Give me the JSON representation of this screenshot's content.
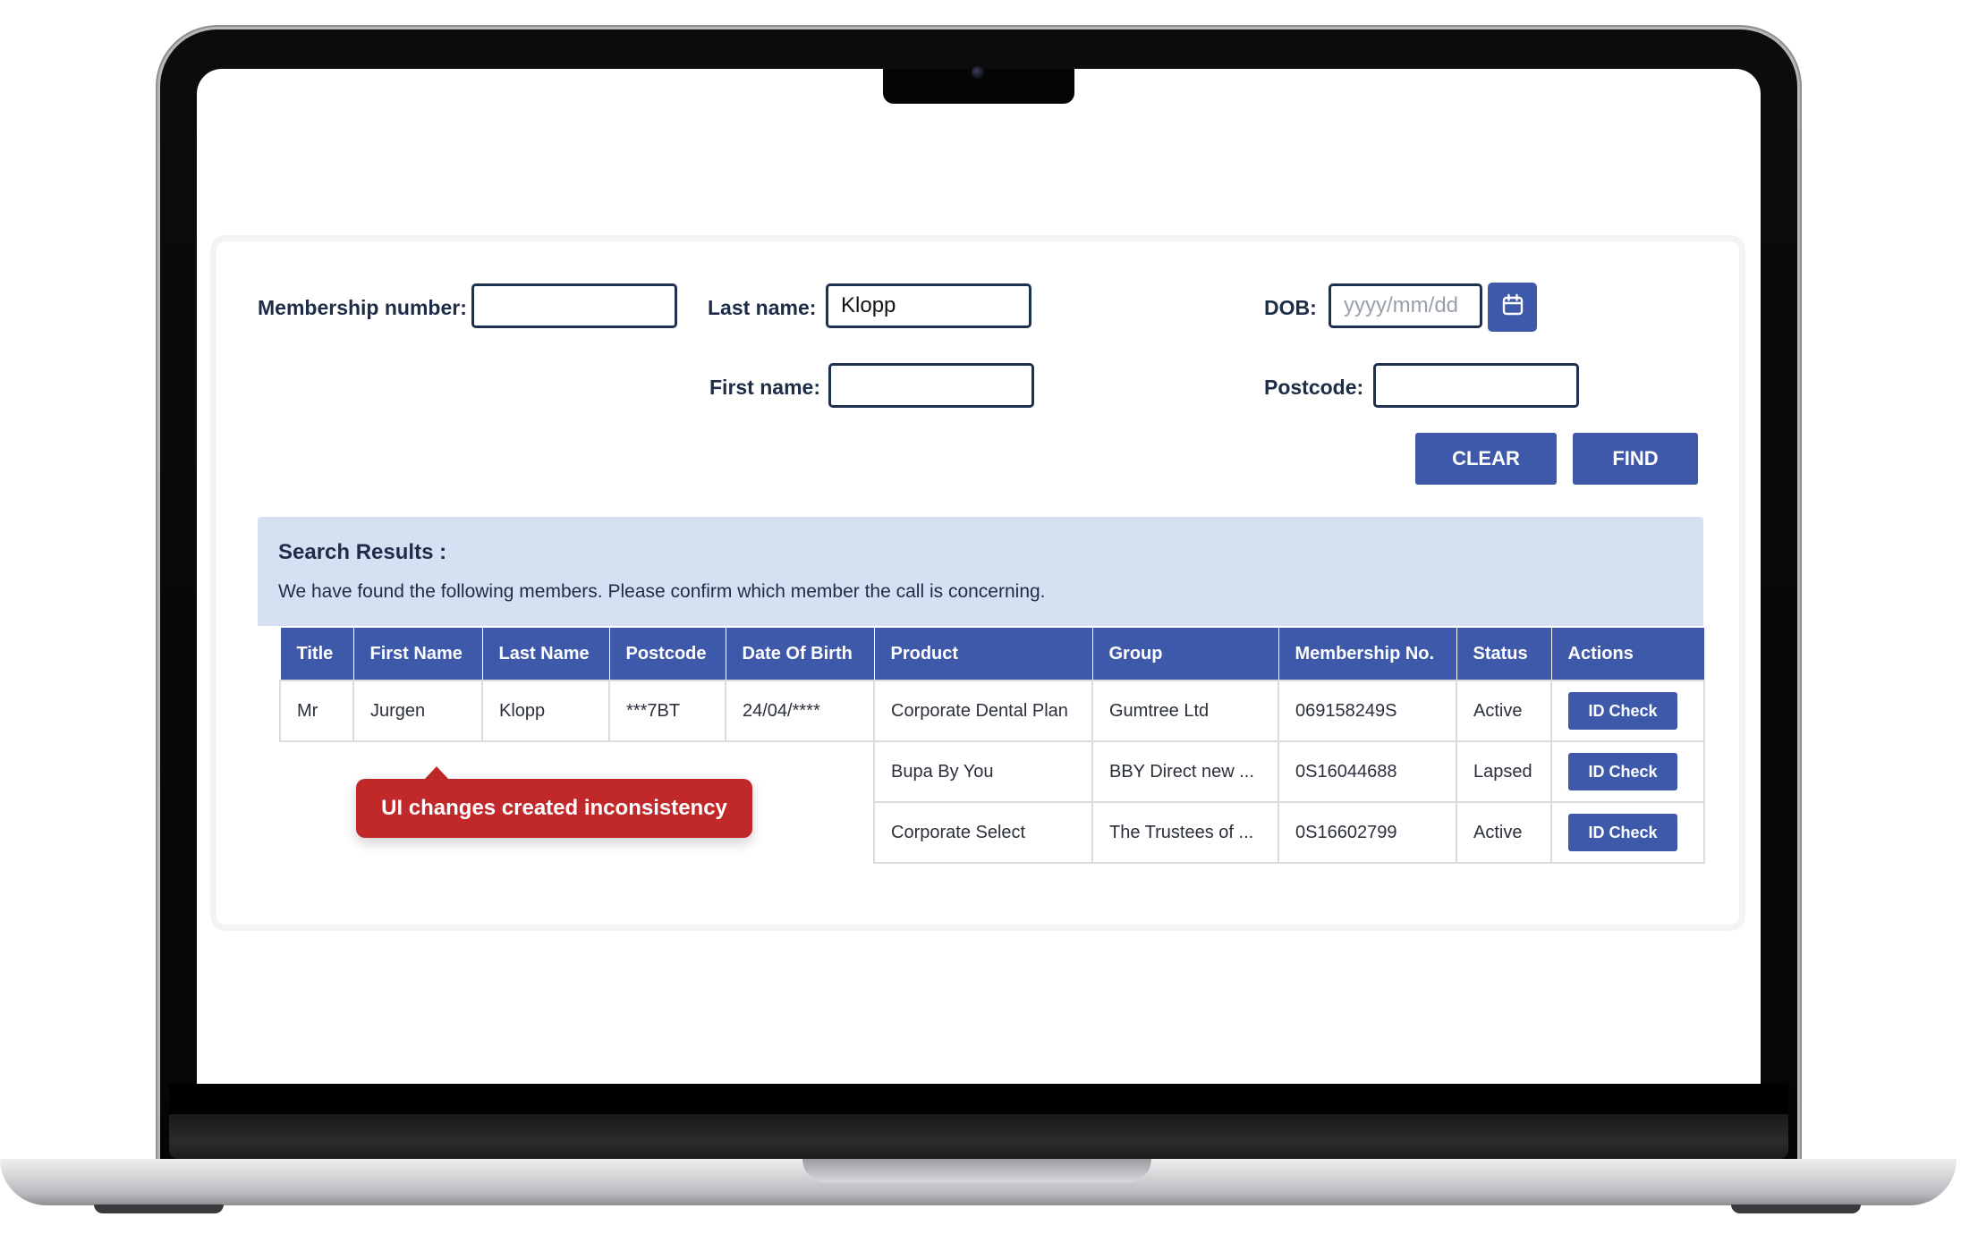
{
  "search_form": {
    "membership_number_label": "Membership number:",
    "membership_number_value": "",
    "last_name_label": "Last name:",
    "last_name_value": "Klopp",
    "first_name_label": "First name:",
    "first_name_value": "",
    "dob_label": "DOB:",
    "dob_placeholder": "yyyy/mm/dd",
    "postcode_label": "Postcode:",
    "postcode_value": "",
    "clear_label": "CLEAR",
    "find_label": "FIND"
  },
  "results": {
    "title": "Search Results :",
    "subtitle": "We have found the following members. Please confirm which member the call is concerning.",
    "columns": [
      "Title",
      "First Name",
      "Last Name",
      "Postcode",
      "Date Of Birth",
      "Product",
      "Group",
      "Membership No.",
      "Status",
      "Actions"
    ],
    "person": {
      "title": "Mr",
      "first_name": "Jurgen",
      "last_name": "Klopp",
      "postcode": "***7BT",
      "dob": "24/04/****"
    },
    "rows": [
      {
        "product": "Corporate Dental Plan",
        "group": "Gumtree Ltd",
        "membership_no": "069158249S",
        "status": "Active",
        "action": "ID Check"
      },
      {
        "product": "Bupa By You",
        "group": "BBY Direct new ...",
        "membership_no": "0S16044688",
        "status": "Lapsed",
        "action": "ID Check"
      },
      {
        "product": "Corporate Select",
        "group": "The Trustees of ...",
        "membership_no": "0S16602799",
        "status": "Active",
        "action": "ID Check"
      }
    ]
  },
  "annotation": {
    "text": "UI changes created inconsistency"
  },
  "colors": {
    "primary": "#3e59a9",
    "banner": "#d5e0f2",
    "annotation": "#c0282a"
  },
  "icons": {
    "date_picker": "calendar-icon"
  }
}
